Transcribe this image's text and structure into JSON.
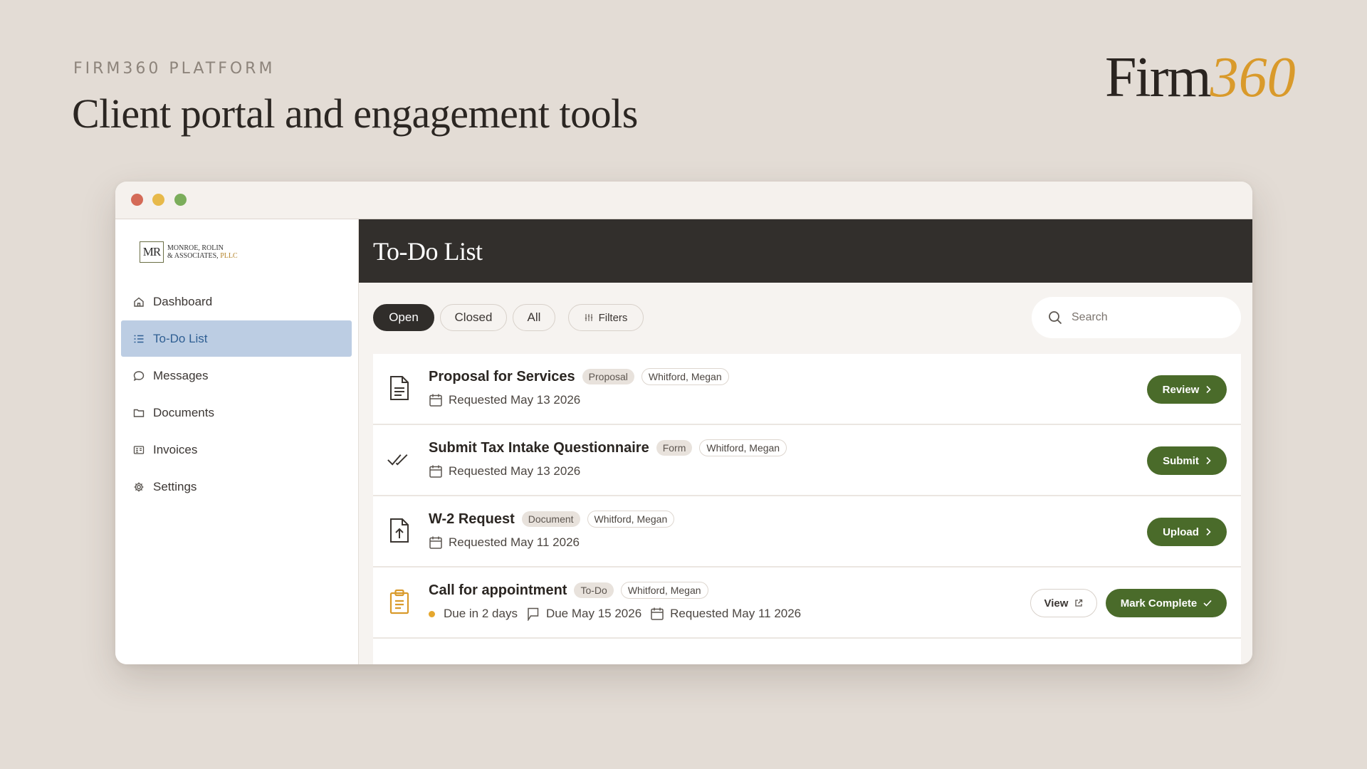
{
  "slide": {
    "eyebrow": "FIRM360 PLATFORM",
    "headline": "Client portal and engagement tools",
    "brand_word": "Firm",
    "brand_number": "360"
  },
  "sidebar": {
    "logo_mark": "MR",
    "logo_line1": "MONROE, ROLIN",
    "logo_line2": "& ASSOCIATES,",
    "logo_suffix": "PLLC",
    "items": [
      {
        "label": "Dashboard",
        "icon": "home-icon",
        "active": false
      },
      {
        "label": "To-Do List",
        "icon": "list-icon",
        "active": true
      },
      {
        "label": "Messages",
        "icon": "chat-bubble-icon",
        "active": false
      },
      {
        "label": "Documents",
        "icon": "folder-icon",
        "active": false
      },
      {
        "label": "Invoices",
        "icon": "invoice-icon",
        "active": false
      },
      {
        "label": "Settings",
        "icon": "gear-icon",
        "active": false
      }
    ]
  },
  "main": {
    "title": "To-Do List",
    "filters": {
      "open": "Open",
      "closed": "Closed",
      "all": "All",
      "filters": "Filters",
      "active": "Open"
    },
    "search_placeholder": "Search"
  },
  "todos": [
    {
      "title": "Proposal for Services",
      "type": "Proposal",
      "person": "Whitford, Megan",
      "requested": "Requested May 13 2026",
      "icon": "document-icon",
      "action": "Review"
    },
    {
      "title": "Submit Tax Intake Questionnaire",
      "type": "Form",
      "person": "Whitford, Megan",
      "requested": "Requested May 13 2026",
      "icon": "double-check-icon",
      "action": "Submit"
    },
    {
      "title": "W-2 Request",
      "type": "Document",
      "person": "Whitford, Megan",
      "requested": "Requested May 11 2026",
      "icon": "file-upload-icon",
      "action": "Upload"
    },
    {
      "title": "Call for appointment",
      "type": "To-Do",
      "person": "Whitford, Megan",
      "due_status": "Due in 2 days",
      "due_date": "Due May 15 2026",
      "requested": "Requested May 11 2026",
      "icon": "clipboard-icon",
      "secondary_action": "View",
      "action": "Mark Complete"
    }
  ],
  "colors": {
    "background": "#e3dcd5",
    "header": "#322f2c",
    "accent_green": "#4a6b2a",
    "active_nav": "#bccde3",
    "brand_gold": "#d99a2b"
  }
}
